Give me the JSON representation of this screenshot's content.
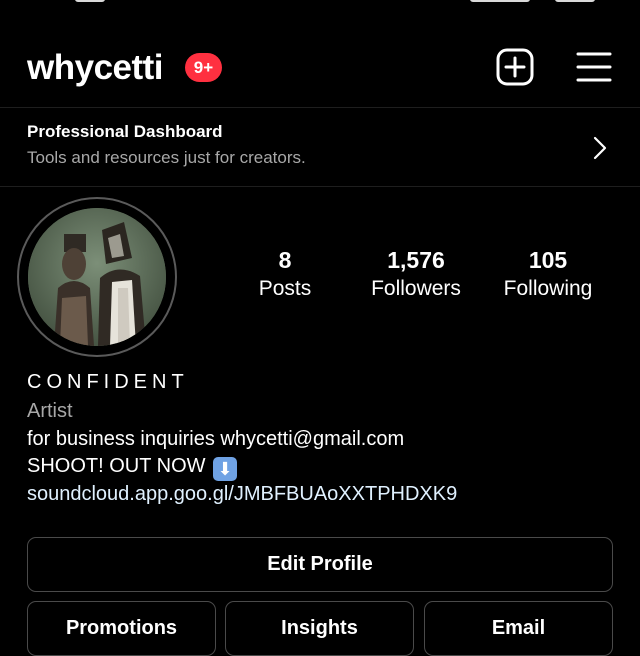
{
  "header": {
    "username": "whycetti",
    "notification_badge": "9+",
    "badge_color": "#ff3040"
  },
  "dashboard": {
    "title": "Professional Dashboard",
    "subtitle": "Tools and resources just for creators."
  },
  "stats": [
    {
      "value": "8",
      "label": "Posts"
    },
    {
      "value": "1,576",
      "label": "Followers"
    },
    {
      "value": "105",
      "label": "Following"
    }
  ],
  "bio": {
    "name": "CONFIDENT",
    "category": "Artist",
    "line1": "for business inquiries whycetti@gmail.com",
    "line2": "SHOOT! OUT NOW",
    "emoji": "⬇",
    "link": "soundcloud.app.goo.gl/JMBFBUAoXXTPHDXK9"
  },
  "buttons": {
    "edit_profile": "Edit Profile",
    "promotions": "Promotions",
    "insights": "Insights",
    "email": "Email"
  },
  "icons": {
    "new_post": "plus-square-icon",
    "menu": "hamburger-menu-icon",
    "dashboard_chevron": "chevron-right-icon",
    "avatar": "profile-avatar"
  },
  "colors": {
    "background": "#000000",
    "text": "#ffffff",
    "secondary_text": "#a8a8a8",
    "link": "#e0f1ff",
    "button_border": "#4a4a4a"
  }
}
